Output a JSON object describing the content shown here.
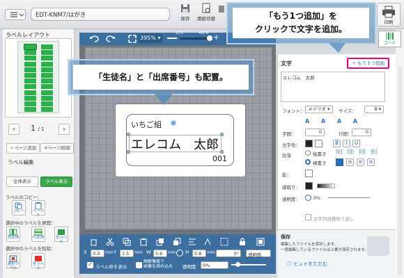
{
  "doc_name": "EDT-KNM7/はがき",
  "toolbar": {
    "save": "保存",
    "paper": "用紙切替",
    "print": "印刷"
  },
  "left": {
    "layout_title": "ラベルレイアウト",
    "page": "1",
    "page_total": "/ 1",
    "add_page": "ページ追加",
    "del_page": "ページ削除",
    "edit_title": "ラベル編集",
    "show_all": "全体表示",
    "show_label": "ラベル表示",
    "copy_title": "ラベルのコピー：",
    "copy": "コピー",
    "paste": "ペースト",
    "expand_title": "選択中のラベルを展開：",
    "expand_col": "列全体",
    "expand_row": "行全体",
    "expand_all": "全ラベル",
    "delete_title": "選択中のラベルを削除：",
    "delete_sel": "選択ラベル",
    "delete_all": "全ラベル"
  },
  "canvas": {
    "zoom": "395%",
    "zoom_min": "25%",
    "zoom_max": "400%",
    "label_line1": "いちご組",
    "label_name": "エレコム　太郎",
    "label_num": "001"
  },
  "bottom": {
    "x_label": "X",
    "x": "0.3",
    "y_label": "Y",
    "y": "1.5",
    "w_label": "W",
    "w": "5.6",
    "h_label": "H",
    "h": "0.8",
    "unit": "mm",
    "rot": "0°",
    "transparent": "透明色",
    "show_frame": "ラベル枠を表示",
    "hires": "高解像度で",
    "hires2": "画像を読み込み",
    "opacity_label": "透明度",
    "opacity": "0%"
  },
  "right": {
    "text_title": "文字",
    "add_text": "＋ もう１つ追加",
    "text_value": "エレコム　太郎",
    "font_label": "フォント：",
    "font": "メイリオ",
    "size_label": "サイズ：",
    "size": "8",
    "char_spacing": "字間：",
    "char_spacing_val": "0",
    "line_spacing": "行間：",
    "line_spacing_val": "0",
    "text_color": "文字色：",
    "direction": "段落",
    "vertical": "縦書き",
    "horizontal": "横書き",
    "shadow": "影：",
    "outline": "縁取り：",
    "opacity": "透明度：",
    "opacity_val": "0%",
    "auto_wrap": "文字列自動折り返し"
  },
  "hint": {
    "title": "保存",
    "body1": "編集したファイルを保存します。",
    "body2": "一度編集しているファイルは上書き保存されます。",
    "fold": "ヒントをたたむ"
  },
  "callouts": {
    "top1": "「もう1つ追加」を",
    "top2": "クリックで文字を追加。",
    "mid": "「生徒名」と「出席番号」も配置。"
  },
  "side": {
    "code": "コード"
  }
}
